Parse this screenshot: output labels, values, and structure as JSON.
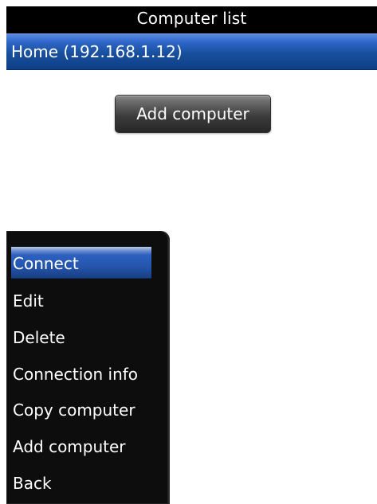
{
  "window": {
    "title": "Computer list"
  },
  "computer_list": {
    "items": [
      {
        "label": "Home (192.168.1.12)",
        "state": "selected"
      }
    ]
  },
  "actions": {
    "add_computer_button_label": "Add computer"
  },
  "context_menu": {
    "items": [
      {
        "label": "Connect",
        "state": "selected"
      },
      {
        "label": "Edit"
      },
      {
        "label": "Delete"
      },
      {
        "label": "Connection info"
      },
      {
        "label": "Copy computer"
      },
      {
        "label": "Add computer"
      },
      {
        "label": "Back"
      }
    ]
  },
  "theme": {
    "title_bar_color": "#000000",
    "selection_blue": "#184f9d",
    "menu_background": "#0d0d0d",
    "button_gray": "#3c3c3c",
    "text_white": "#ffffff"
  }
}
